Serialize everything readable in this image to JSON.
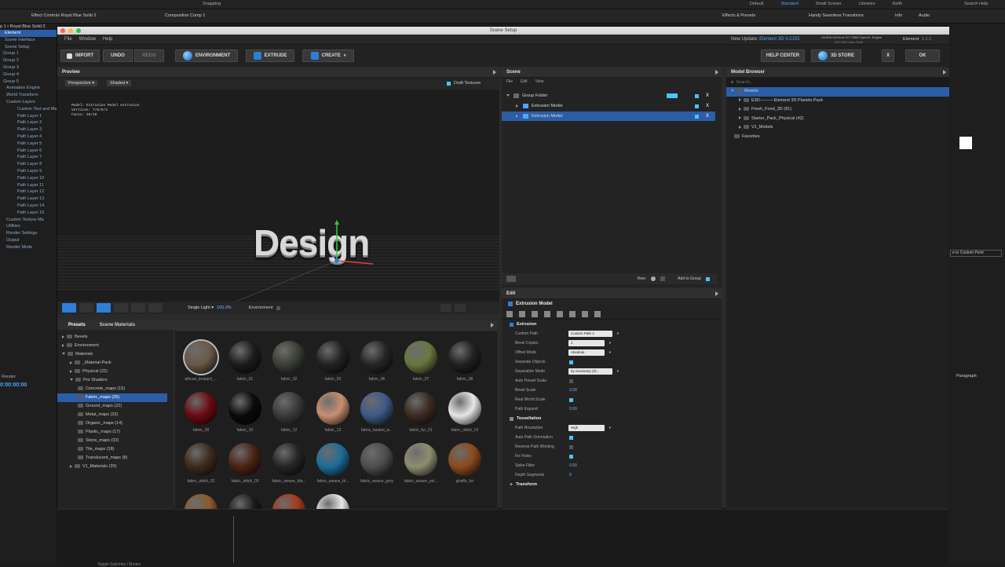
{
  "ae": {
    "top_tabs": [
      "Effect Controls Royal Blue Solid 2",
      "Composition Comp 1"
    ],
    "snapping": "Snapping",
    "workspaces": [
      "Default",
      "Standard",
      "Small Screen",
      "Libraries",
      "Keith"
    ],
    "search_help": "Search Help",
    "right_tabs": [
      "Effects & Presets",
      "Handy Seamless Transitions",
      "Info",
      "Audio"
    ],
    "left_header": "p 1 • Royal Blue Solid 2",
    "left_tree": [
      {
        "label": "Element",
        "hl": true
      },
      {
        "label": "Scene Interface",
        "hl": false
      },
      {
        "label": "Scene Setup",
        "hl": false
      },
      {
        "label": "Group 1",
        "hl": false
      },
      {
        "label": "Group 2",
        "hl": false
      },
      {
        "label": "Group 3",
        "hl": false
      },
      {
        "label": "Group 4",
        "hl": false
      },
      {
        "label": "Group 5",
        "hl": false
      },
      {
        "label": "Animation Engine",
        "hl": false
      },
      {
        "label": "World Transform",
        "hl": false
      },
      {
        "label": "Custom Layers",
        "hl": false
      },
      {
        "label": "Custom Text and Ma",
        "hl": false
      },
      {
        "label": "Path Layer 1",
        "hl": false
      },
      {
        "label": "Path Layer 2",
        "hl": false
      },
      {
        "label": "Path Layer 3",
        "hl": false
      },
      {
        "label": "Path Layer 4",
        "hl": false
      },
      {
        "label": "Path Layer 5",
        "hl": false
      },
      {
        "label": "Path Layer 6",
        "hl": false
      },
      {
        "label": "Path Layer 7",
        "hl": false
      },
      {
        "label": "Path Layer 8",
        "hl": false
      },
      {
        "label": "Path Layer 9",
        "hl": false
      },
      {
        "label": "Path Layer 10",
        "hl": false
      },
      {
        "label": "Path Layer 11",
        "hl": false
      },
      {
        "label": "Path Layer 12",
        "hl": false
      },
      {
        "label": "Path Layer 13",
        "hl": false
      },
      {
        "label": "Path Layer 14",
        "hl": false
      },
      {
        "label": "Path Layer 15",
        "hl": false
      },
      {
        "label": "Custom Texture Ma",
        "hl": false
      },
      {
        "label": "Utilities",
        "hl": false
      },
      {
        "label": "Render Settings",
        "hl": false
      },
      {
        "label": "Output",
        "hl": false
      },
      {
        "label": "Render Mode",
        "hl": false
      }
    ],
    "timecode": "0:00:00:00",
    "render_label": "Render",
    "paragraph": "Paragraph",
    "add_custom_point": "e to Custom Point",
    "bottom_label": "Toggle Switches / Modes"
  },
  "window": {
    "title": "Scene Setup",
    "menus": [
      "File",
      "Window",
      "Help"
    ],
    "update_label": "New Update:",
    "update_value": "Element 3D V.2155",
    "gpu": "NVIDIA GeForce GT 755M OpenGL Engine",
    "vram": "1024 MB Video RAM",
    "app_name": "Element",
    "app_version": "2.2.2"
  },
  "toolbar": {
    "import": "IMPORT",
    "undo": "UNDO",
    "redo": "REDO",
    "environment": "ENVIRONMENT",
    "extrude": "EXTRUDE",
    "create": "CREATE",
    "help_center": "HELP CENTER",
    "store": "3D STORE",
    "close": "X",
    "ok": "OK"
  },
  "preview": {
    "title": "Preview",
    "camera": "Perspective",
    "shading": "Shaded",
    "draft_textures": "Draft Textures",
    "info_model": "Model: Extrusion Model extrusion",
    "info_vertices": "Vertices: 7/8/9/2",
    "info_faces": "Faces: 38/28",
    "text": "Design",
    "light": "Single Light",
    "zoom": "100.0%",
    "environment": "Environment"
  },
  "scene": {
    "title": "Scene",
    "menus": [
      "File",
      "Edit",
      "View"
    ],
    "items": [
      {
        "label": "Group Folder",
        "level": 0,
        "selected": false
      },
      {
        "label": "Extrusion Model",
        "level": 1,
        "selected": false
      },
      {
        "label": "Extrusion Model",
        "level": 1,
        "selected": true
      }
    ],
    "view": "View:",
    "add_to_group": "Add to Group"
  },
  "model_browser": {
    "title": "Model Browser",
    "search_placeholder": "Search...",
    "items": [
      {
        "label": "Models",
        "selected": true
      },
      {
        "label": "E3D——— Element 3D Planets Pack",
        "selected": false
      },
      {
        "label": "Fresh_Food_3D (81)",
        "selected": false
      },
      {
        "label": "Starter_Pack_Physical (42)",
        "selected": false
      },
      {
        "label": "V1_Models",
        "selected": false
      },
      {
        "label": "Favorites",
        "selected": false
      }
    ]
  },
  "presets": {
    "tab_presets": "Presets",
    "tab_scene_materials": "Scene Materials",
    "tree": [
      {
        "label": "Bevels",
        "level": 0,
        "selected": false
      },
      {
        "label": "Environment",
        "level": 0,
        "selected": false
      },
      {
        "label": "Materials",
        "level": 0,
        "selected": false
      },
      {
        "label": "_Material-Pack",
        "level": 1,
        "selected": false
      },
      {
        "label": "Physical (22)",
        "level": 1,
        "selected": false
      },
      {
        "label": "Pro Shaders",
        "level": 1,
        "selected": false
      },
      {
        "label": "Concrete_maps (15)",
        "level": 2,
        "selected": false
      },
      {
        "label": "Fabric_maps (25)",
        "level": 2,
        "selected": true
      },
      {
        "label": "Ground_maps (22)",
        "level": 2,
        "selected": false
      },
      {
        "label": "Metal_maps (22)",
        "level": 2,
        "selected": false
      },
      {
        "label": "Organic_maps (14)",
        "level": 2,
        "selected": false
      },
      {
        "label": "Plastic_maps (17)",
        "level": 2,
        "selected": false
      },
      {
        "label": "Stone_maps (33)",
        "level": 2,
        "selected": false
      },
      {
        "label": "Tile_maps (18)",
        "level": 2,
        "selected": false
      },
      {
        "label": "Translucent_maps (8)",
        "level": 2,
        "selected": false
      },
      {
        "label": "V1_Materials (20)",
        "level": 1,
        "selected": false
      }
    ]
  },
  "materials": [
    {
      "label": "african_leopard_...",
      "color": "#6b5848"
    },
    {
      "label": "fabric_01",
      "color": "#1c1c1c"
    },
    {
      "label": "fabric_02",
      "color": "#3b3f34"
    },
    {
      "label": "fabric_03",
      "color": "#222222"
    },
    {
      "label": "fabric_06",
      "color": "#252525"
    },
    {
      "label": "fabric_07",
      "color": "#69773e"
    },
    {
      "label": "fabric_08",
      "color": "#202020"
    },
    {
      "label": "fabric_09",
      "color": "#6a0b12"
    },
    {
      "label": "fabric_10",
      "color": "#0a0a0a"
    },
    {
      "label": "fabric_12",
      "color": "#3a3a3a"
    },
    {
      "label": "fabric_13",
      "color": "#c98f6f"
    },
    {
      "label": "fabric_basket_w...",
      "color": "#3d5a86"
    },
    {
      "label": "fabric_fur_01",
      "color": "#3a2a22"
    },
    {
      "label": "fabric_stitch_01",
      "color": "#e6e6e6"
    },
    {
      "label": "fabric_stitch_02",
      "color": "#3e2a1c"
    },
    {
      "label": "fabric_stitch_03",
      "color": "#4a2314"
    },
    {
      "label": "fabric_weave_bla...",
      "color": "#242424"
    },
    {
      "label": "fabric_weave_bl...",
      "color": "#1e6c98"
    },
    {
      "label": "fabric_weave_grey",
      "color": "#4d4d4d"
    },
    {
      "label": "fabric_weave_yel...",
      "color": "#8e8e6e"
    },
    {
      "label": "giraffe_fur",
      "color": "#8a4a1e"
    }
  ],
  "edit": {
    "title": "Edit",
    "model_name": "Extrusion Model",
    "extrusion_section": "Extrusion",
    "extrusion": [
      {
        "label": "Custom Path",
        "type": "dropdown",
        "value": "Custom Path 2"
      },
      {
        "label": "Bevel Copies",
        "type": "dropdown",
        "value": "1"
      },
      {
        "label": "Offset Mode",
        "type": "dropdown",
        "value": "Absolute"
      },
      {
        "label": "Separate Objects",
        "type": "check",
        "value": "on"
      },
      {
        "label": "Separation Mode",
        "type": "dropdown",
        "value": "by Geometry (Sl..."
      },
      {
        "label": "Auto Preset Scale",
        "type": "check",
        "value": "off"
      },
      {
        "label": "Bevel Scale",
        "type": "value",
        "value": "3.00"
      },
      {
        "label": "Real World Scale",
        "type": "check",
        "value": "on"
      },
      {
        "label": "Path Expand",
        "type": "value",
        "value": "0.00"
      }
    ],
    "tessellation_section": "Tessellation",
    "tessellation": [
      {
        "label": "Path Resolution",
        "type": "dropdown",
        "value": "High"
      },
      {
        "label": "Auto Path Orientation",
        "type": "check",
        "value": "on"
      },
      {
        "label": "Reverse Path Winding",
        "type": "check",
        "value": "off"
      },
      {
        "label": "Fix Holes",
        "type": "check",
        "value": "on"
      },
      {
        "label": "Spike Filter",
        "type": "value",
        "value": "0.50"
      },
      {
        "label": "Depth Segments",
        "type": "value",
        "value": "0"
      }
    ],
    "transform_section": "Transform"
  },
  "colors": {
    "accent": "#2d7fd8",
    "selection": "#2c5ea8",
    "cyan": "#4bc3ff"
  }
}
